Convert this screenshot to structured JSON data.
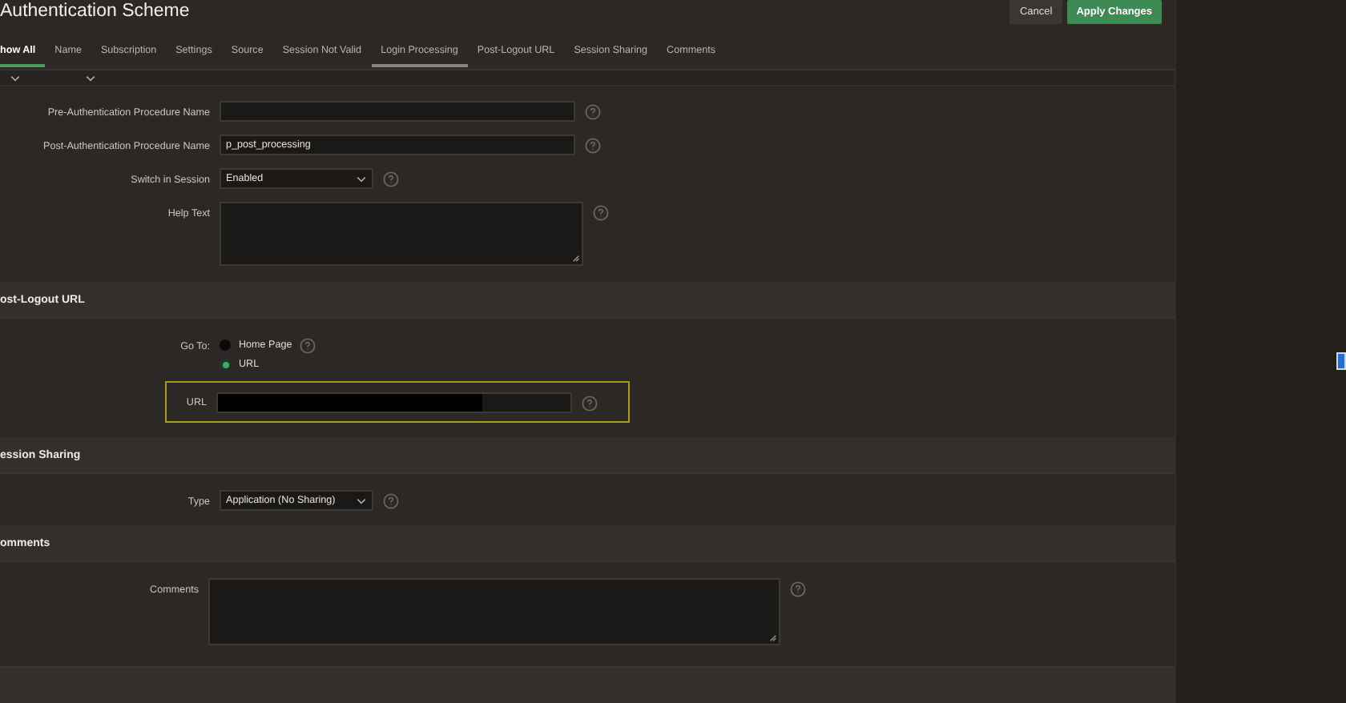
{
  "title": "Authentication Scheme",
  "buttons": [
    {
      "label": "Cancel",
      "kind": "secondary"
    },
    {
      "label": "Apply Changes",
      "kind": "primary"
    }
  ],
  "tabs": [
    {
      "label": "how All",
      "selected": true,
      "current": false
    },
    {
      "label": "Name",
      "selected": false,
      "current": false
    },
    {
      "label": "Subscription",
      "selected": false,
      "current": false
    },
    {
      "label": "Settings",
      "selected": false,
      "current": false
    },
    {
      "label": "Source",
      "selected": false,
      "current": false
    },
    {
      "label": "Session Not Valid",
      "selected": false,
      "current": false
    },
    {
      "label": "Login Processing",
      "selected": false,
      "current": true
    },
    {
      "label": "Post-Logout URL",
      "selected": false,
      "current": false
    },
    {
      "label": "Session Sharing",
      "selected": false,
      "current": false
    },
    {
      "label": "Comments",
      "selected": false,
      "current": false
    }
  ],
  "login_processing": {
    "fields": [
      {
        "label": "Pre-Authentication Procedure Name",
        "kind": "text"
      },
      {
        "label": "Post-Authentication Procedure Name",
        "kind": "text",
        "value": "p_post_processing"
      },
      {
        "label": "Switch in Session",
        "kind": "select",
        "value": "Enabled"
      },
      {
        "label": "Help Text",
        "kind": "textarea"
      }
    ]
  },
  "post_logout_url": {
    "heading": "ost-Logout URL",
    "go_to": {
      "label": "Go To:",
      "options": [
        {
          "label": "Home Page",
          "selected": false
        },
        {
          "label": "URL",
          "selected": true
        }
      ]
    },
    "url": {
      "label": "URL",
      "redacted": true,
      "highlighted": true
    }
  },
  "session_sharing": {
    "heading": "ession Sharing",
    "type": {
      "label": "Type",
      "value": "Application (No Sharing)"
    }
  },
  "comments": {
    "heading": "omments",
    "field": {
      "label": "Comments"
    }
  }
}
